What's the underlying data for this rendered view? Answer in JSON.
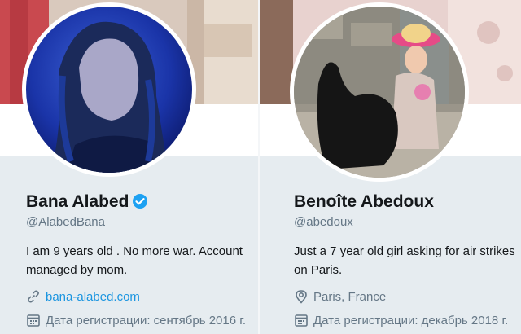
{
  "profiles": [
    {
      "name": "Bana Alabed",
      "verified": true,
      "handle": "@AlabedBana",
      "bio": "I am 9 years old . No more war. Account managed by mom.",
      "website": "bana-alabed.com",
      "joined": "Дата регистрации: сентябрь 2016 г.",
      "icons": {
        "verified": "verified-badge-icon",
        "link": "link-icon",
        "calendar": "calendar-icon"
      },
      "colors": {
        "link": "#1b95e0",
        "verified": "#1da1f2"
      }
    },
    {
      "name": "Benoîte Abedoux",
      "verified": false,
      "handle": "@abedoux",
      "bio": "Just a 7 year old girl asking for air strikes on Paris.",
      "location": "Paris, France",
      "joined": "Дата регистрации: декабрь 2018 г.",
      "icons": {
        "location": "location-pin-icon",
        "calendar": "calendar-icon"
      }
    }
  ]
}
